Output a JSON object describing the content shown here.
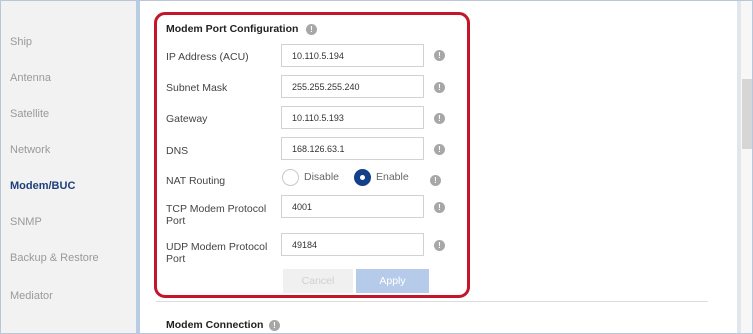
{
  "sidebar": {
    "items": [
      {
        "label": "Ship",
        "active": false
      },
      {
        "label": "Antenna",
        "active": false
      },
      {
        "label": "Satellite",
        "active": false
      },
      {
        "label": "Network",
        "active": false
      },
      {
        "label": "Modem/BUC",
        "active": true
      },
      {
        "label": "SNMP",
        "active": false
      },
      {
        "label": "Backup & Restore",
        "active": false
      },
      {
        "label": "Mediator",
        "active": false
      }
    ]
  },
  "modem_port": {
    "title": "Modem Port Configuration",
    "fields": [
      {
        "label": "IP Address (ACU)",
        "value": "10.110.5.194"
      },
      {
        "label": "Subnet Mask",
        "value": "255.255.255.240"
      },
      {
        "label": "Gateway",
        "value": "10.110.5.193"
      },
      {
        "label": "DNS",
        "value": "168.126.63.1"
      },
      {
        "label_line1": "TCP Modem Protocol",
        "label_line2": "Port",
        "value": "4001"
      },
      {
        "label_line1": "UDP Modem Protocol",
        "label_line2": "Port",
        "value": "49184"
      }
    ],
    "nat_routing": {
      "label": "NAT Routing",
      "options": [
        "Disable",
        "Enable"
      ],
      "selected": "Enable"
    },
    "cancel_label": "Cancel",
    "apply_label": "Apply",
    "info_glyph": "!"
  },
  "modem_connection": {
    "title": "Modem Connection"
  },
  "colors": {
    "accent": "#14408a",
    "active_nav": "#1f3f7a",
    "highlight_border": "#c3162a",
    "apply_disabled": "#b6cbe9"
  }
}
